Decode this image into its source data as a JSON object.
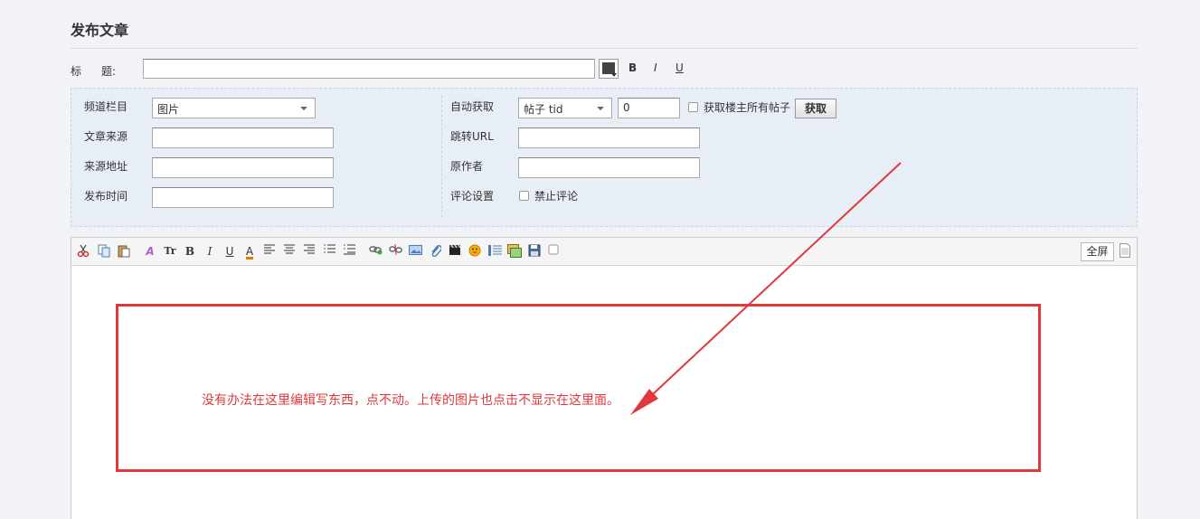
{
  "page": {
    "title": "发布文章"
  },
  "title_row": {
    "label": "标",
    "label2": "题:",
    "value": "",
    "bold": "B",
    "italic": "I",
    "underline": "U"
  },
  "settings": {
    "channel": {
      "label": "频道栏目",
      "value": "图片"
    },
    "source": {
      "label": "文章来源",
      "value": ""
    },
    "source_url": {
      "label": "来源地址",
      "value": ""
    },
    "publish_time": {
      "label": "发布时间",
      "value": ""
    },
    "auto_fetch": {
      "label": "自动获取",
      "select_value": "帖子 tid",
      "input_value": "0",
      "checkbox_label": "获取楼主所有帖子",
      "button_label": "获取"
    },
    "redirect_url": {
      "label": "跳转URL",
      "value": ""
    },
    "author": {
      "label": "原作者",
      "value": ""
    },
    "comment": {
      "label": "评论设置",
      "checkbox_label": "禁止评论"
    }
  },
  "editor": {
    "fullscreen_label": "全屏",
    "toolbar_text": {
      "bold": "B",
      "italic": "I",
      "underline": "U",
      "font_size": "Tr",
      "font_color": "A"
    }
  },
  "annotation": {
    "text": "没有办法在这里编辑写东西，点不动。上传的图片也点击不显示在这里面。",
    "color": "#e0383d"
  },
  "colors": {
    "accent": "#e0383d",
    "panel_bg": "#e8eef5"
  }
}
